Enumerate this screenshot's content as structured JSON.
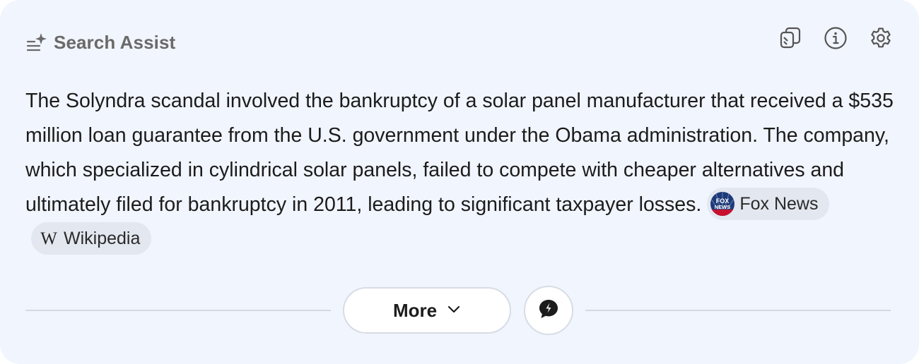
{
  "header": {
    "title": "Search Assist",
    "title_icon": "sparkle-list-icon",
    "actions": [
      {
        "name": "copy",
        "icon": "copy-icon"
      },
      {
        "name": "info",
        "icon": "info-icon"
      },
      {
        "name": "settings",
        "icon": "gear-icon"
      }
    ]
  },
  "answer": {
    "text": "The Solyndra scandal involved the bankruptcy of a solar panel manufacturer that received a $535 million loan guarantee from the U.S. government under the Obama administration. The company, which specialized in cylindrical solar panels, failed to compete with cheaper alternatives and ultimately filed for bankruptcy in 2011, leading to significant taxpayer losses.",
    "sources": [
      {
        "label": "Fox News",
        "icon": "fox-news-logo",
        "logo_text": "FOX NEWS"
      },
      {
        "label": "Wikipedia",
        "icon": "wikipedia-icon",
        "glyph": "W"
      }
    ]
  },
  "footer": {
    "more_label": "More",
    "more_icon": "chevron-down-icon",
    "chat_icon": "chat-bubble-icon"
  },
  "colors": {
    "card_bg": "#f1f5fd",
    "chip_bg": "#e3e7ef",
    "title": "#6a6a6a",
    "text": "#1c1c1c",
    "fox_blue": "#1d3a7a",
    "fox_red": "#c8102e"
  }
}
